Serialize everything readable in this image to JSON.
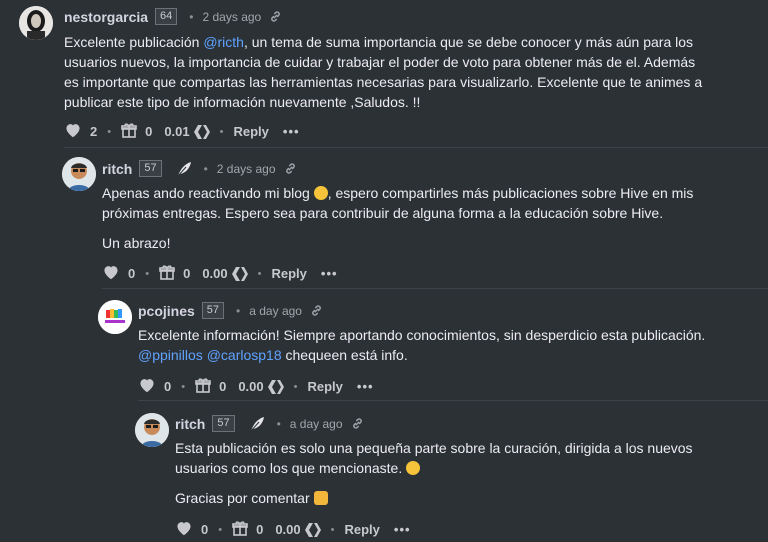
{
  "comments": [
    {
      "author": "nestorgarcia",
      "rep": "64",
      "time": "2 days ago",
      "body_p1_pre": "Excelente publicación ",
      "body_p1_mention": "@ricth",
      "body_p1_post": ", un tema de suma importancia que se debe conocer y más aún para los usuarios nuevos, la importancia de cuidar y trabajar el poder de voto para obtener más de el. Además es importante que compartas las herramientas necesarias para visualizarlo. Excelente que te animes a publicar este tipo de información nuevamente ,Saludos. !!",
      "votes": "2",
      "reblogs": "0",
      "payout": "0.01",
      "reply": "Reply"
    },
    {
      "author": "ritch",
      "rep": "57",
      "time": "2 days ago",
      "body_p1_pre": "Apenas ando reactivando mi blog ",
      "body_p1_post": ", espero compartirles más publicaciones sobre Hive en mis próximas entregas. Espero sea para contribuir de alguna forma a la educación sobre Hive.",
      "body_p2": "Un abrazo!",
      "votes": "0",
      "reblogs": "0",
      "payout": "0.00",
      "reply": "Reply"
    },
    {
      "author": "pcojines",
      "rep": "57",
      "time": "a day ago",
      "body_p1": "Excelente información! Siempre aportando conocimientos, sin desperdicio esta publicación.",
      "mention1": "@ppinillos",
      "mention2": "@carlosp18",
      "body_p1_post": " chequeen está info.",
      "votes": "0",
      "reblogs": "0",
      "payout": "0.00",
      "reply": "Reply"
    },
    {
      "author": "ritch",
      "rep": "57",
      "time": "a day ago",
      "body_p1": "Esta publicación es solo una pequeña parte sobre la curación, dirigida a los nuevos usuarios como los que mencionaste. ",
      "body_p2": "Gracias por comentar ",
      "votes": "0",
      "reblogs": "0",
      "payout": "0.00",
      "reply": "Reply"
    }
  ],
  "icons": {
    "upvote": "heart-icon",
    "reblog": "gift-icon",
    "link": "link-icon",
    "feather": "feather-icon",
    "hbd": "hive-icon"
  },
  "colors": {
    "background": "#2c3136",
    "mention": "#5fa3ff",
    "text": "#ececf2"
  }
}
